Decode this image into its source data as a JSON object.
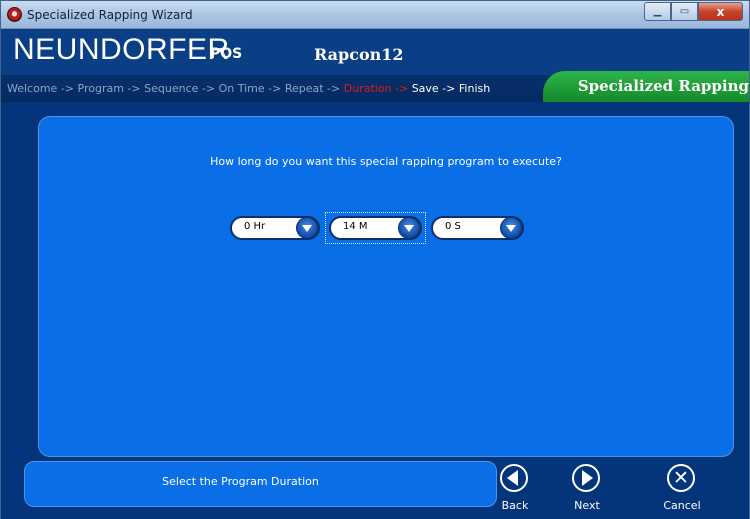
{
  "window": {
    "title": "Specialized Rapping Wizard",
    "minimize_icon": "minimize-icon",
    "maximize_icon": "maximize-icon",
    "close_label": "x"
  },
  "header": {
    "brand": "NEUNDORFER",
    "brand_sub": "POS",
    "project": "Rapcon12"
  },
  "breadcrumb": {
    "steps": [
      {
        "label": "Welcome",
        "state": "done"
      },
      {
        "label": "Program",
        "state": "done"
      },
      {
        "label": "Sequence",
        "state": "done"
      },
      {
        "label": "On Time",
        "state": "done"
      },
      {
        "label": "Repeat",
        "state": "done"
      },
      {
        "label": "Duration",
        "state": "active"
      },
      {
        "label": "Save",
        "state": "future"
      },
      {
        "label": "Finish",
        "state": "future"
      }
    ],
    "separator": " -> ",
    "wizard_name": "Specialized Rapping"
  },
  "main": {
    "question": "How long do you want this special rapping program to execute?",
    "hours": {
      "value": "0 Hr"
    },
    "minutes": {
      "value": "14 M"
    },
    "seconds": {
      "value": "0 S"
    }
  },
  "footer": {
    "status": "Select the Program Duration",
    "back_label": "Back",
    "next_label": "Next",
    "cancel_label": "Cancel"
  },
  "colors": {
    "background": "#04357a",
    "panel": "#0a6fe6",
    "active_step": "#e01818",
    "wizard_tab": "#1f9d37"
  }
}
